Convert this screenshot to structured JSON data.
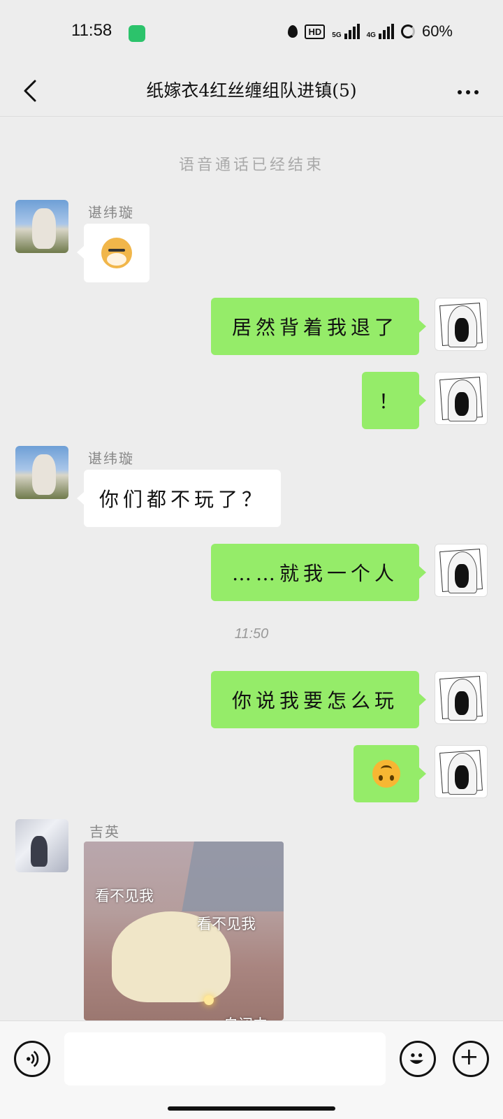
{
  "status_bar": {
    "time": "11:58",
    "hd_label": "HD",
    "net_5g": "5G",
    "net_4g": "4G",
    "battery": "60%"
  },
  "header": {
    "title": "纸嫁衣4红丝缠组队进镇(5)"
  },
  "system_notice": "语音通话已经结束",
  "time_divider": "11:50",
  "messages": [
    {
      "sender": "谌纬璇",
      "type": "sticker",
      "sticker": "doge-sticker"
    },
    {
      "sender": "me",
      "type": "text",
      "text": "居然背着我退了"
    },
    {
      "sender": "me",
      "type": "text",
      "text": "！"
    },
    {
      "sender": "谌纬璇",
      "type": "text",
      "text": "你们都不玩了？"
    },
    {
      "sender": "me",
      "type": "text",
      "text": "……就我一个人"
    },
    {
      "sender": "me",
      "type": "text",
      "text": "你说我要怎么玩"
    },
    {
      "sender": "me",
      "type": "emoji",
      "emoji": "upside-down-face"
    },
    {
      "sender": "吉英",
      "type": "image",
      "captions": [
        "看不见我",
        "看不见我",
        "自闭中"
      ]
    }
  ],
  "input_bar": {
    "placeholder": "",
    "voice_icon": "voice-icon",
    "emoji_icon": "emoji-icon",
    "plus_icon": "plus-icon"
  },
  "colors": {
    "self_bubble": "#95ec69",
    "other_bubble": "#ffffff",
    "background": "#ededed"
  }
}
